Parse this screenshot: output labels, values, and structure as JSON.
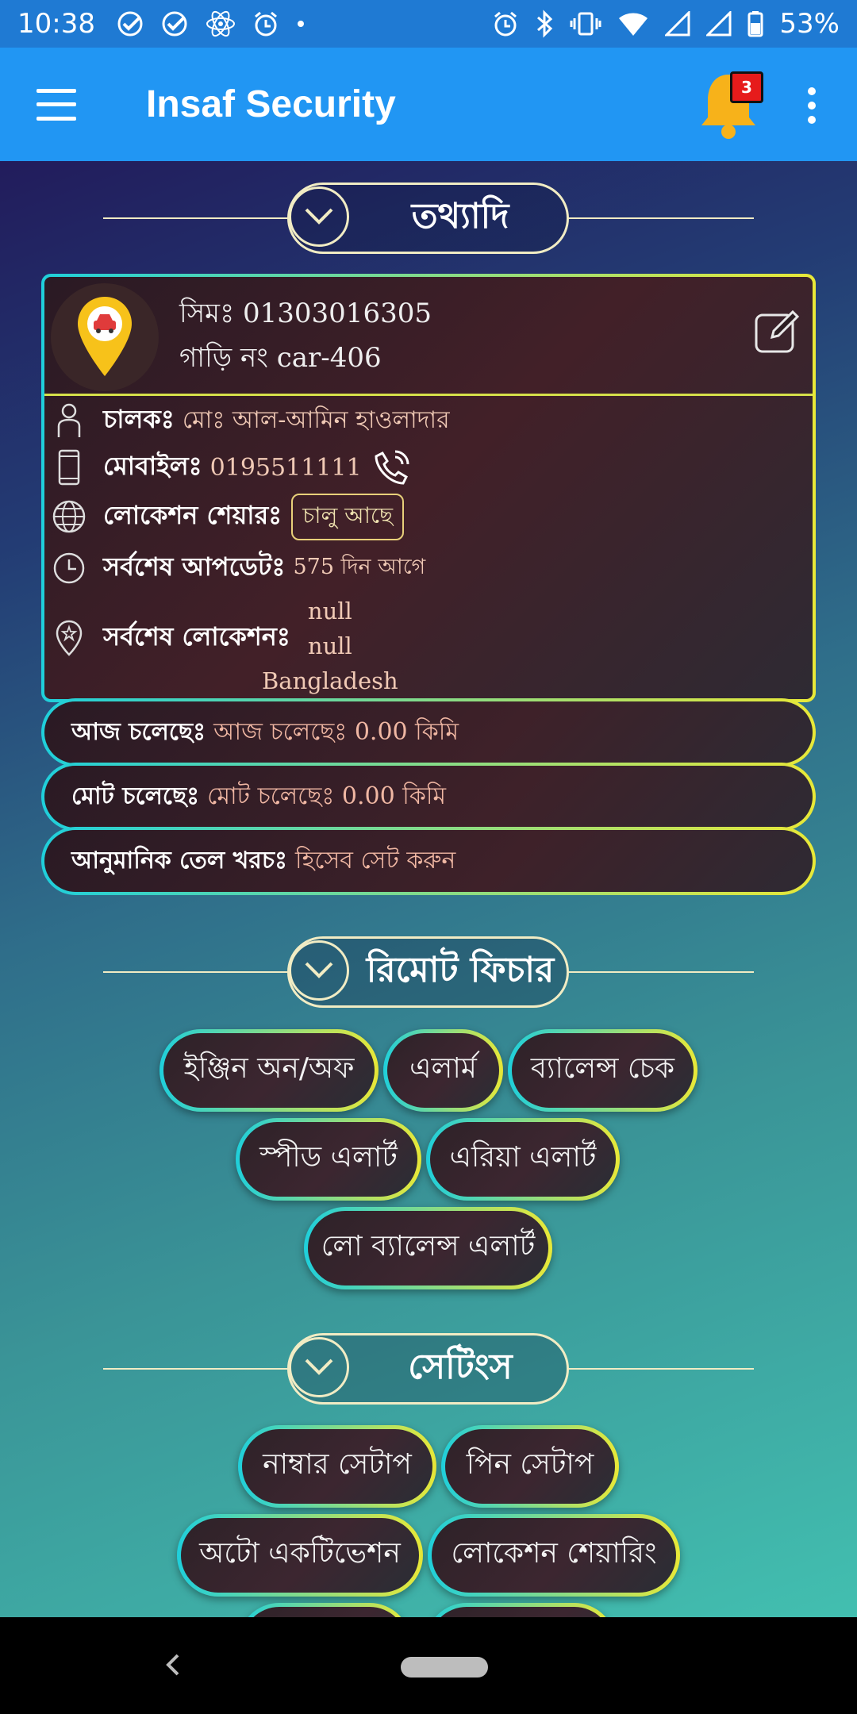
{
  "status_bar": {
    "time": "10:38",
    "battery": "53%",
    "left_icons": [
      "check-circle-icon",
      "check-circle-icon",
      "react-atom-icon",
      "alarm-icon",
      "dot-icon"
    ],
    "right_icons": [
      "alarm-icon",
      "bluetooth-icon",
      "vibrate-icon",
      "wifi-icon",
      "signal-icon",
      "signal-icon",
      "battery-icon"
    ]
  },
  "app_bar": {
    "title": "Insaf Security",
    "notification_count": "3"
  },
  "sections": {
    "info": "তথ্যাদি",
    "remote": "রিমোট ফিচার",
    "settings": "সেটিংস"
  },
  "vehicle": {
    "sim_label": "সিমঃ",
    "sim_value": "01303016305",
    "car_label": "গাড়ি নং",
    "car_value": "car-406"
  },
  "details": {
    "driver_label": "চালকঃ",
    "driver_value": "মোঃ আল-আমিন হাওলাদার",
    "mobile_label": "মোবাইলঃ",
    "mobile_value": "0195511111",
    "location_share_label": "লোকেশন শেয়ারঃ",
    "location_share_value": "চালু আছে",
    "last_update_label": "সর্বশেষ আপডেটঃ",
    "last_update_value": "575 দিন আগে",
    "last_location_label": "সর্বশেষ লোকেশনঃ",
    "last_location_lines": [
      "null",
      "null",
      "Bangladesh"
    ]
  },
  "stats": {
    "today_label": "আজ চলেছেঃ",
    "today_value": "আজ চলেছেঃ 0.00  কিমি",
    "total_label": "মোট চলেছেঃ",
    "total_value": "মোট চলেছেঃ 0.00 কিমি",
    "fuel_label": "আনুমানিক তেল খরচঃ",
    "fuel_value": "হিসেব সেট করুন"
  },
  "remote_buttons": [
    "ইঞ্জিন অন/অফ",
    "এলার্ম",
    "ব্যালেন্স চেক",
    "স্পীড এলার্ট",
    "এরিয়া এলার্ট",
    "লো ব্যালেন্স এলার্ট"
  ],
  "settings_buttons": [
    "নাম্বার সেটাপ",
    "পিন সেটাপ",
    "অটো একটিভেশন",
    "লোকেশন শেয়ারিং"
  ],
  "colors": {
    "app_bar": "#2196f3",
    "status_bar": "#1f7ad3",
    "bell": "#f7b21a",
    "badge": "#e61b1b",
    "border_start": "#1fcfdb",
    "border_end": "#e8e838"
  }
}
